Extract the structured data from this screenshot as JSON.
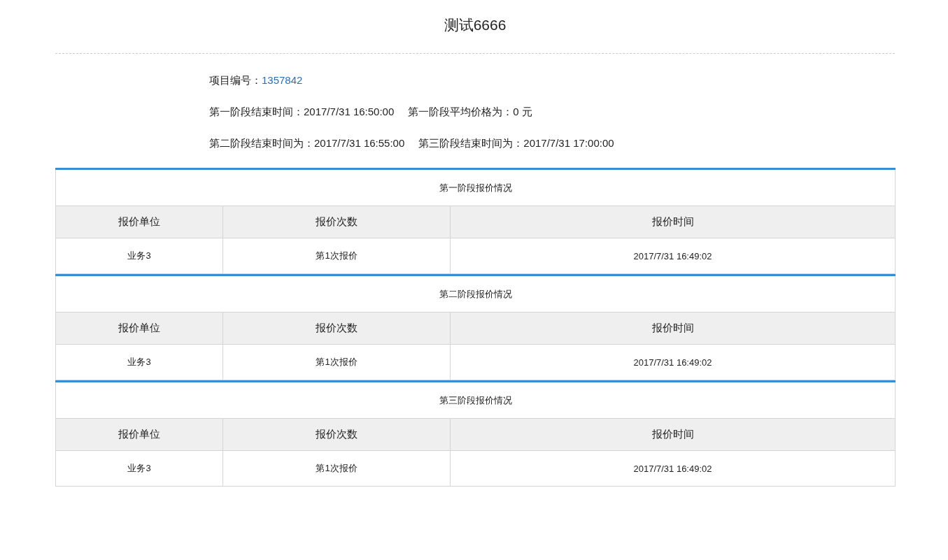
{
  "title": "测试6666",
  "project": {
    "label": "项目编号：",
    "value": "1357842"
  },
  "info_lines": [
    [
      "第一阶段结束时间：2017/7/31 16:50:00",
      "第一阶段平均价格为：0 元"
    ],
    [
      "第二阶段结束时间为：2017/7/31 16:55:00",
      "第三阶段结束时间为：2017/7/31 17:00:00"
    ]
  ],
  "sections": [
    {
      "caption": "第一阶段报价情况",
      "columns": [
        "报价单位",
        "报价次数",
        "报价时间"
      ],
      "rows": [
        [
          "业务3",
          "第1次报价",
          "2017/7/31 16:49:02"
        ]
      ]
    },
    {
      "caption": "第二阶段报价情况",
      "columns": [
        "报价单位",
        "报价次数",
        "报价时间"
      ],
      "rows": [
        [
          "业务3",
          "第1次报价",
          "2017/7/31 16:49:02"
        ]
      ]
    },
    {
      "caption": "第三阶段报价情况",
      "columns": [
        "报价单位",
        "报价次数",
        "报价时间"
      ],
      "rows": [
        [
          "业务3",
          "第1次报价",
          "2017/7/31 16:49:02"
        ]
      ]
    }
  ]
}
